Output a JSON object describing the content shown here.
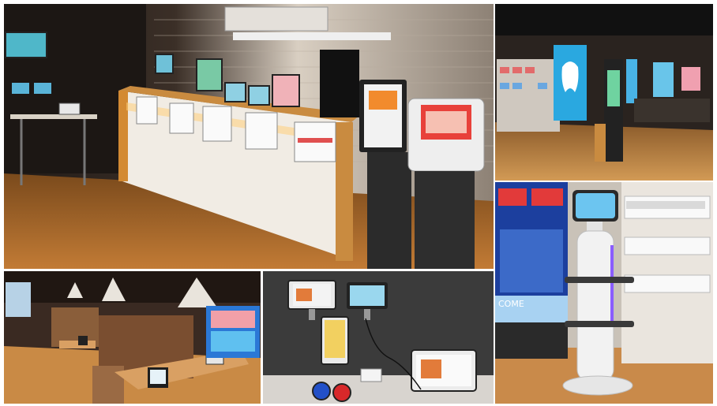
{
  "collage": {
    "panels": [
      {
        "id": "showroom-main",
        "caption": ""
      },
      {
        "id": "store-demo",
        "caption": ""
      },
      {
        "id": "restaurant-booths",
        "caption": ""
      },
      {
        "id": "tablet-terminals",
        "caption": ""
      },
      {
        "id": "delivery-robot",
        "caption": ""
      }
    ]
  },
  "texts": {
    "banner_top": "",
    "robot_screen_welcome": "COME",
    "red_button_1": "",
    "red_button_2": "",
    "red_button_3": ""
  },
  "colors": {
    "wood_floor": "#b8732e",
    "wall_dark": "#2a211c",
    "kiosk_screen_red": "#e8413a",
    "robot_white": "#f2f2f2",
    "robot_accent": "#8a5cff",
    "blue_display": "#2aa8e0"
  }
}
